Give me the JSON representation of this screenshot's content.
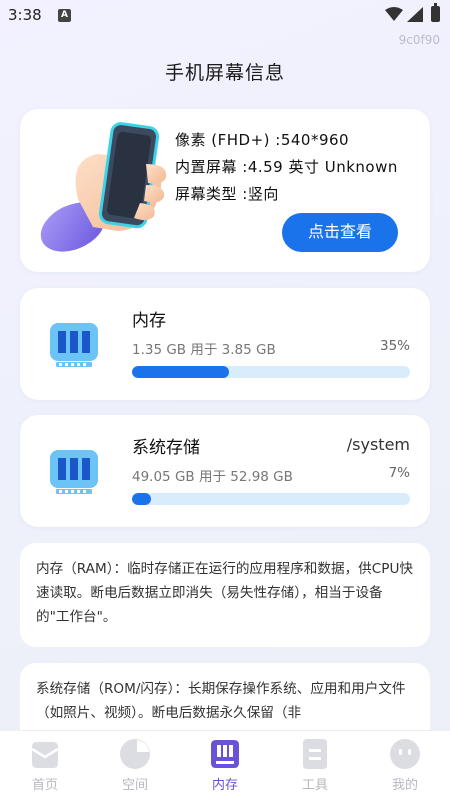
{
  "status_bar": {
    "time": "3:38",
    "badge": "A"
  },
  "watermark": "9c0f90",
  "header": {
    "title": "手机屏幕信息"
  },
  "screen_info": {
    "resolution": "像素 (FHD+) :540*960",
    "size": "内置屏幕 :4.59 英寸 Unknown",
    "orientation": "屏幕类型 :竖向",
    "button_label": "点击查看"
  },
  "memory": {
    "title": "内存",
    "usage": "1.35 GB 用于 3.85 GB",
    "percent": "35%",
    "fraction": 0.35
  },
  "storage": {
    "title": "系统存储",
    "path": "/system",
    "usage": "49.05 GB 用于 52.98 GB",
    "percent": "7%",
    "fraction": 0.07
  },
  "descriptions": {
    "ram": "内存（RAM）：临时存储正在运行的应用程序和数据，供CPU快速读取。断电后数据立即消失（易失性存储），相当于设备的\"工作台\"。",
    "rom": "系统存储（ROM/闪存）：长期保存操作系统、应用和用户文件（如照片、视频）。断电后数据永久保留（非"
  },
  "nav": {
    "items": [
      {
        "label": "首页",
        "icon": "home-icon"
      },
      {
        "label": "空间",
        "icon": "pie-chart-icon"
      },
      {
        "label": "内存",
        "icon": "memory-card-icon",
        "active": true
      },
      {
        "label": "工具",
        "icon": "tools-icon"
      },
      {
        "label": "我的",
        "icon": "profile-face-icon"
      }
    ]
  },
  "colors": {
    "accent": "#1a73ea",
    "nav_active": "#6a52d6",
    "progress_track": "#d9ecfb"
  }
}
